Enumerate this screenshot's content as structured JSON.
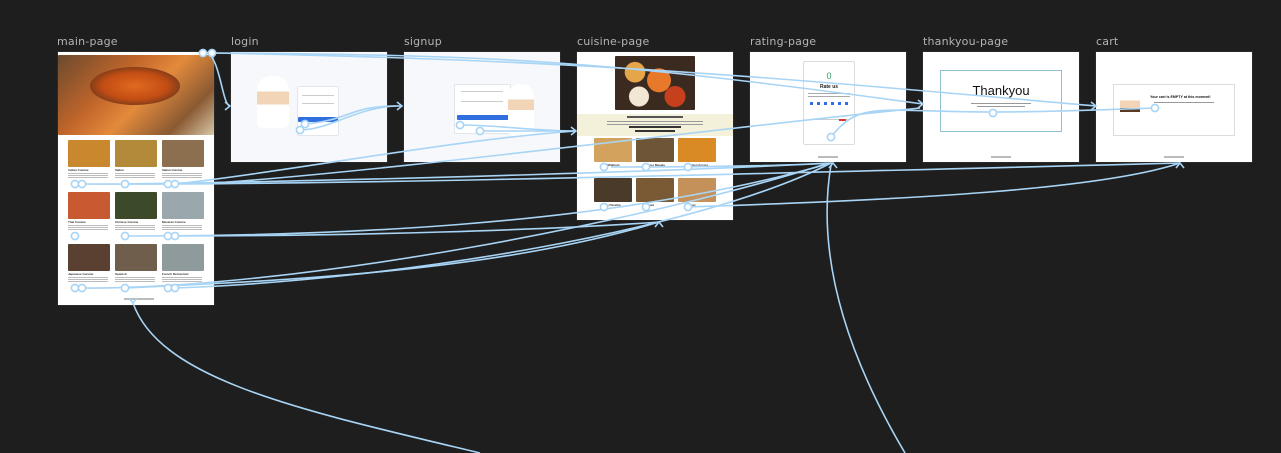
{
  "frames": [
    {
      "id": "main-page",
      "label": "main-page"
    },
    {
      "id": "login",
      "label": "login"
    },
    {
      "id": "signup",
      "label": "signup"
    },
    {
      "id": "cuisine-page",
      "label": "cuisine-page"
    },
    {
      "id": "rating-page",
      "label": "rating-page"
    },
    {
      "id": "thankyou-page",
      "label": "thankyou-page"
    },
    {
      "id": "cart",
      "label": "cart"
    }
  ],
  "main_page": {
    "cuisines": [
      "Indian Cuisine",
      "Italian",
      "Italian Cuisine",
      "Thai Cuisine",
      "Chinese Cuisine",
      "Mexican Cuisine",
      "Japanese Cuisine",
      "Spanish",
      "French Restaurant"
    ]
  },
  "cuisine_page": {
    "dishes": [
      "Dal Makhani",
      "Paneer Masala",
      "Chicken Korma",
      "Aloo Paratha",
      "Biryani",
      "Burger"
    ]
  },
  "rating_page": {
    "score": "0",
    "title": "Rate us"
  },
  "thankyou_page": {
    "heading": "Thankyou"
  },
  "cart_page": {
    "message": "Your cart is EMPTY at this moment!"
  },
  "colors": {
    "wire": "#a8d4f5",
    "canvas": "#1e1e1e",
    "accent_blue": "#2f6fe0"
  }
}
